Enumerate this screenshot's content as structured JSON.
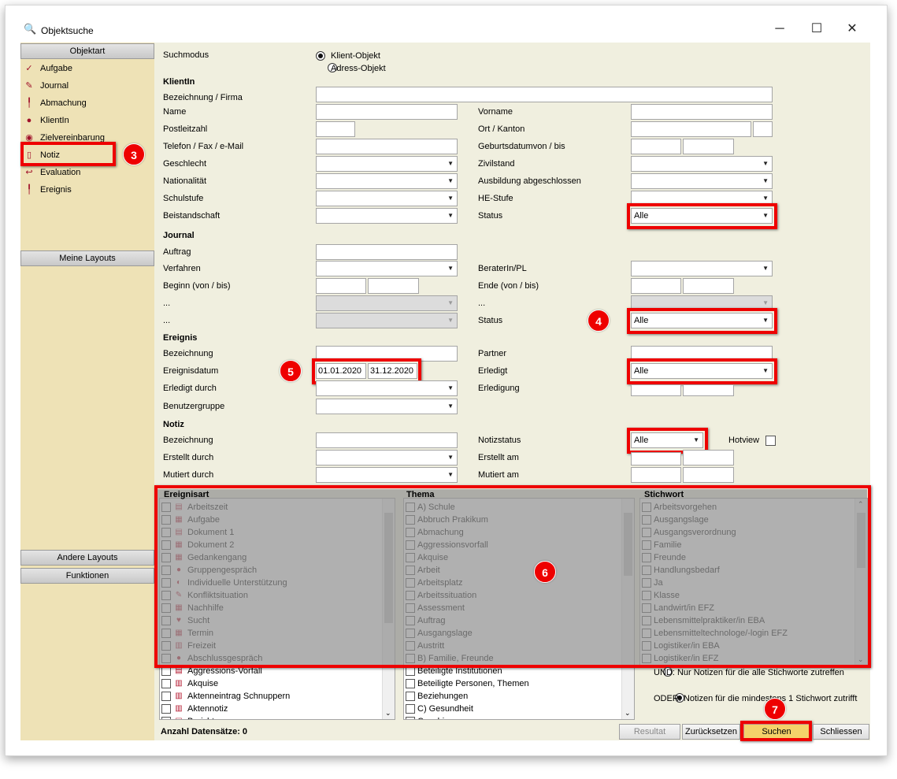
{
  "window": {
    "title": "Objektsuche",
    "minimize": "─",
    "maximize": "☐",
    "close": "✕"
  },
  "sidebar": {
    "header_objektart": "Objektart",
    "items": [
      {
        "label": "Aufgabe",
        "icon": "check-icon"
      },
      {
        "label": "Journal",
        "icon": "pencil-icon"
      },
      {
        "label": "Abmachung",
        "icon": "pin-icon"
      },
      {
        "label": "KlientIn",
        "icon": "person-icon"
      },
      {
        "label": "Zielvereinbarung",
        "icon": "target-icon"
      },
      {
        "label": "Notiz",
        "icon": "note-icon"
      },
      {
        "label": "Evaluation",
        "icon": "evaluation-icon"
      },
      {
        "label": "Ereignis",
        "icon": "pin-icon"
      }
    ],
    "meine_layouts": "Meine Layouts",
    "andere_layouts": "Andere Layouts",
    "funktionen": "Funktionen"
  },
  "form": {
    "suchmodus": "Suchmodus",
    "radio_klient": "Klient-Objekt",
    "radio_adress": "Adress-Objekt",
    "sec_klient": "KlientIn",
    "bezeichnung_firma": "Bezeichnung / Firma",
    "name": "Name",
    "vorname": "Vorname",
    "plz": "Postleitzahl",
    "ort": "Ort / Kanton",
    "telefon": "Telefon / Fax / e-Mail",
    "geburtsdatum": "Geburtsdatumvon / bis",
    "geschlecht": "Geschlecht",
    "zivilstand": "Zivilstand",
    "nationalitaet": "Nationalität",
    "ausbildung": "Ausbildung abgeschlossen",
    "schulstufe": "Schulstufe",
    "he_stufe": "HE-Stufe",
    "beistandschaft": "Beistandschaft",
    "status": "Status",
    "status_value": "Alle",
    "sec_journal": "Journal",
    "auftrag": "Auftrag",
    "verfahren": "Verfahren",
    "berater": "BeraterIn/PL",
    "beginn": "Beginn (von / bis)",
    "ende": "Ende (von / bis)",
    "dots": "...",
    "journal_status": "Status",
    "journal_status_value": "Alle",
    "sec_ereignis": "Ereignis",
    "ereig_bezeichnung": "Bezeichnung",
    "partner": "Partner",
    "ereignisdatum": "Ereignisdatum",
    "datum_von": "01.01.2020",
    "datum_bis": "31.12.2020",
    "erledigt": "Erledigt",
    "erledigt_value": "Alle",
    "erledigt_durch": "Erledigt durch",
    "erledigung": "Erledigung",
    "benutzergruppe": "Benutzergruppe",
    "sec_notiz": "Notiz",
    "notiz_bezeichnung": "Bezeichnung",
    "notizstatus": "Notizstatus",
    "notizstatus_value": "Alle",
    "hotview": "Hotview",
    "erstellt_durch": "Erstellt durch",
    "erstellt_am": "Erstellt am",
    "mutiert_durch": "Mutiert durch",
    "mutiert_am": "Mutiert am"
  },
  "lists": {
    "ereignisart_header": "Ereignisart",
    "thema_header": "Thema",
    "stichwort_header": "Stichwort",
    "ereignisart": [
      {
        "label": "Arbeitszeit",
        "icon": "doc-icon"
      },
      {
        "label": "Aufgabe",
        "icon": "calendar-icon"
      },
      {
        "label": "Dokument 1",
        "icon": "doc-icon"
      },
      {
        "label": "Dokument 2",
        "icon": "calendar-icon"
      },
      {
        "label": "Gedankengang",
        "icon": "calendar-icon"
      },
      {
        "label": "Gruppengespräch",
        "icon": "person-icon"
      },
      {
        "label": "Individuelle Unterstützung",
        "icon": "moon-icon"
      },
      {
        "label": "Konfliktsituation",
        "icon": "pencil-icon"
      },
      {
        "label": "Nachhilfe",
        "icon": "calendar-icon"
      },
      {
        "label": "Sucht",
        "icon": "heart-icon"
      },
      {
        "label": "Termin",
        "icon": "calendar-icon"
      },
      {
        "label": "Freizeit",
        "icon": "gift-icon"
      },
      {
        "label": "Abschlussgespräch",
        "icon": "person-icon"
      },
      {
        "label": "Aggressions-Vorfall",
        "icon": "doc-icon"
      },
      {
        "label": "Akquise",
        "icon": "gift-icon"
      },
      {
        "label": "Aktenneintrag Schnuppern",
        "icon": "gift-icon"
      },
      {
        "label": "Aktennotiz",
        "icon": "gift-icon"
      },
      {
        "label": "Bericht",
        "icon": "doc-icon"
      }
    ],
    "thema": [
      "A) Schule",
      "Abbruch Prakikum",
      "Abmachung",
      "Aggressionsvorfall",
      "Akquise",
      "Arbeit",
      "Arbeitsplatz",
      "Arbeitssituation",
      "Assessment",
      "Auftrag",
      "Ausgangslage",
      "Austritt",
      "B) Familie, Freunde",
      "Beteiligte Institutionen",
      "Beteiligte Personen, Themen",
      "Beziehungen",
      "C) Gesundheit",
      "Coaching"
    ],
    "stichwort": [
      "Arbeitsvorgehen",
      "Ausgangslage",
      "Ausgangsverordnung",
      "Familie",
      "Freunde",
      "Handlungsbedarf",
      "Ja",
      "Klasse",
      "Landwirt/in EFZ",
      "Lebensmittelpraktiker/in EBA",
      "Lebensmitteltechnologe/-login EFZ",
      "Logistiker/in EBA",
      "Logistiker/in EFZ"
    ],
    "und_option": "UND: Nur Notizen für die alle Stichworte zutreffen",
    "oder_option": "ODER: Notizen für die mindestens 1 Stichwort zutrifft"
  },
  "footer": {
    "anzahl": "Anzahl Datensätze: 0",
    "resultat": "Resultat",
    "zuruecksetzen": "Zurücksetzen",
    "suchen": "Suchen",
    "schliessen": "Schliessen"
  },
  "badges": [
    "3",
    "4",
    "5",
    "6",
    "7"
  ],
  "colors": {
    "highlight": "#e00000",
    "sidebar": "#eee2b6",
    "panel": "#f0efdf"
  }
}
